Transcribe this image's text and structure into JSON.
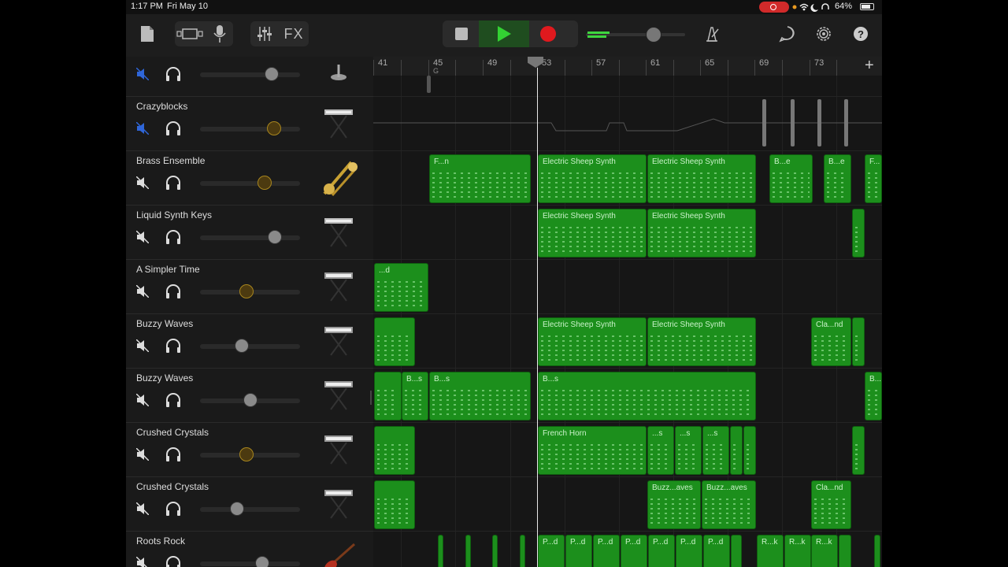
{
  "status_bar": {
    "time": "1:17 PM",
    "date": "Fri May 10",
    "battery": "64%"
  },
  "toolbar": {
    "fx_label": "FX",
    "help_label": "?"
  },
  "ruler": {
    "bars": [
      "41",
      "45",
      "49",
      "53",
      "57",
      "61",
      "65",
      "69",
      "73"
    ],
    "marker": "G"
  },
  "colors": {
    "region_green": "#1c8f1c",
    "record_red": "#e0191e",
    "play_green": "#33d233"
  },
  "tracks": [
    {
      "name": "Crazyblocks",
      "instrument": "keyboard-stand-icon",
      "muted": true,
      "volume": 0.74
    },
    {
      "name": "Brass Ensemble",
      "instrument": "brass-icon",
      "muted": false,
      "volume": 0.65
    },
    {
      "name": "Liquid Synth Keys",
      "instrument": "keyboard-stand-icon",
      "muted": false,
      "volume": 0.75
    },
    {
      "name": "A Simpler Time",
      "instrument": "keyboard-stand-icon",
      "muted": false,
      "volume": 0.46
    },
    {
      "name": "Buzzy Waves",
      "instrument": "keyboard-stand-icon",
      "muted": false,
      "volume": 0.42
    },
    {
      "name": "Buzzy Waves",
      "instrument": "keyboard-stand-icon",
      "muted": false,
      "volume": 0.5
    },
    {
      "name": "Crushed Crystals",
      "instrument": "keyboard-stand-icon",
      "muted": false,
      "volume": 0.46
    },
    {
      "name": "Crushed Crystals",
      "instrument": "keyboard-stand-icon",
      "muted": false,
      "volume": 0.37
    },
    {
      "name": "Roots Rock",
      "instrument": "guitar-icon",
      "muted": false,
      "volume": 0.6
    }
  ],
  "regions": {
    "r1": "F...n",
    "r2": "Electric Sheep Synth",
    "r3": "Electric Sheep Synth",
    "r4": "B...e",
    "r5": "B...e",
    "r6": "F...",
    "r7": "Electric Sheep Synth",
    "r8": "Electric Sheep Synth",
    "r9": "...d",
    "r10": "Electric Sheep Synth",
    "r11": "Electric Sheep Synth",
    "r12": "Cla...nd",
    "r13": "B...s",
    "r14": "B...s",
    "r15": "B...s",
    "r16": "B...",
    "r17": "French Horn",
    "r18": "...s",
    "r19": "...s",
    "r20": "...s",
    "r21": "Buzz...aves",
    "r22": "Buzz...aves",
    "r23": "Cla...nd",
    "r24": "P...d",
    "r25": "P...d",
    "r26": "P...d",
    "r27": "P...d",
    "r28": "P...d",
    "r29": "P...d",
    "r30": "P...d",
    "r31": "R...k",
    "r32": "R...k",
    "r33": "R...k"
  }
}
